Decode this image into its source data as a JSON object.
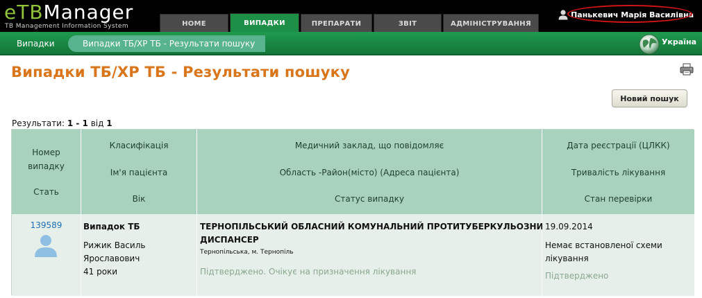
{
  "app": {
    "logo_e": "e",
    "logo_tb": "TB",
    "logo_rest": "Manager",
    "logo_subtitle": "TB Management Information System"
  },
  "nav": {
    "tabs": [
      {
        "label": "HOME",
        "active": false
      },
      {
        "label": "ВИПАДКИ",
        "active": true
      },
      {
        "label": "ПРЕПАРАТИ",
        "active": false
      },
      {
        "label": "ЗВІТ",
        "active": false
      },
      {
        "label": "АДМІНІСТРУВАННЯ",
        "active": false
      }
    ]
  },
  "user": {
    "name": "Панькевич Марія Василівна",
    "icon": "user-icon"
  },
  "breadcrumb": {
    "root": "Випадки",
    "current": "Випадки ТБ/ХР ТБ - Результати пошуку"
  },
  "country": {
    "label": "Україна",
    "icon": "globe-icon"
  },
  "page": {
    "title": "Випадки ТБ/ХР ТБ - Результати пошуку",
    "new_search_label": "Новий пошук",
    "results_prefix": "Результати:",
    "results_range": "1 - 1",
    "results_of": "від",
    "results_total": "1"
  },
  "table": {
    "headers": {
      "col1": [
        "Номер",
        "випадку",
        "Стать"
      ],
      "col2": [
        "Класифікація",
        "Ім'я пацієнта",
        "Вік"
      ],
      "col3": [
        "Медичний заклад, що повідомляє",
        "Область -Район(місто) (Адреса пацієнта)",
        "Статус випадку"
      ],
      "col4": [
        "Дата реєстрації (ЦЛКК)",
        "Тривалість лікування",
        "Стан перевірки"
      ]
    },
    "rows": [
      {
        "case_number": "139589",
        "classification": "Випадок ТБ",
        "patient_name_1": "Рижик Василь",
        "patient_name_2": "Ярославович",
        "age": "41 роки",
        "facility_1": "ТЕРНОПІЛЬСЬКИЙ ОБЛАСНИЙ КОМУНАЛЬНИЙ ПРОТИТУБЕРКУЛЬОЗНИЙ",
        "facility_2": "ДИСПАНСЕР",
        "address": "Тернопільська, м. Тернопіль",
        "case_status": "Підтверджено. Очікує на призначення лікування",
        "reg_date": "19.09.2014",
        "treatment_1": "Немає встановленої схеми",
        "treatment_2": "лікування",
        "verification": "Підтверджено"
      }
    ]
  },
  "colors": {
    "accent_orange": "#d9751a",
    "header_green": "#1e8f47",
    "table_header": "#a8d2bd",
    "row_bg": "#e6efe9",
    "link_blue": "#1c6fb5"
  }
}
